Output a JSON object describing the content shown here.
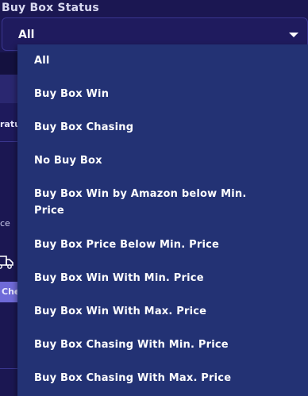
{
  "filter": {
    "label": "Buy Box Status",
    "selected": "All",
    "options": [
      "All",
      "Buy Box Win",
      "Buy Box Chasing",
      "No Buy Box",
      "Buy Box Win by Amazon below Min. Price",
      "Buy Box Price Below Min. Price",
      "Buy Box Win With Min. Price",
      "Buy Box Win With Max. Price",
      "Buy Box Chasing With Min. Price",
      "Buy Box Chasing With Max. Price"
    ]
  },
  "background": {
    "fragment_1": "ratu",
    "fragment_2": "ce",
    "fragment_3": "Che",
    "icon": "truck-icon"
  },
  "colors": {
    "page_bg": "#1b1752",
    "dropdown_bg": "#233274",
    "accent": "#6f6ad8"
  }
}
